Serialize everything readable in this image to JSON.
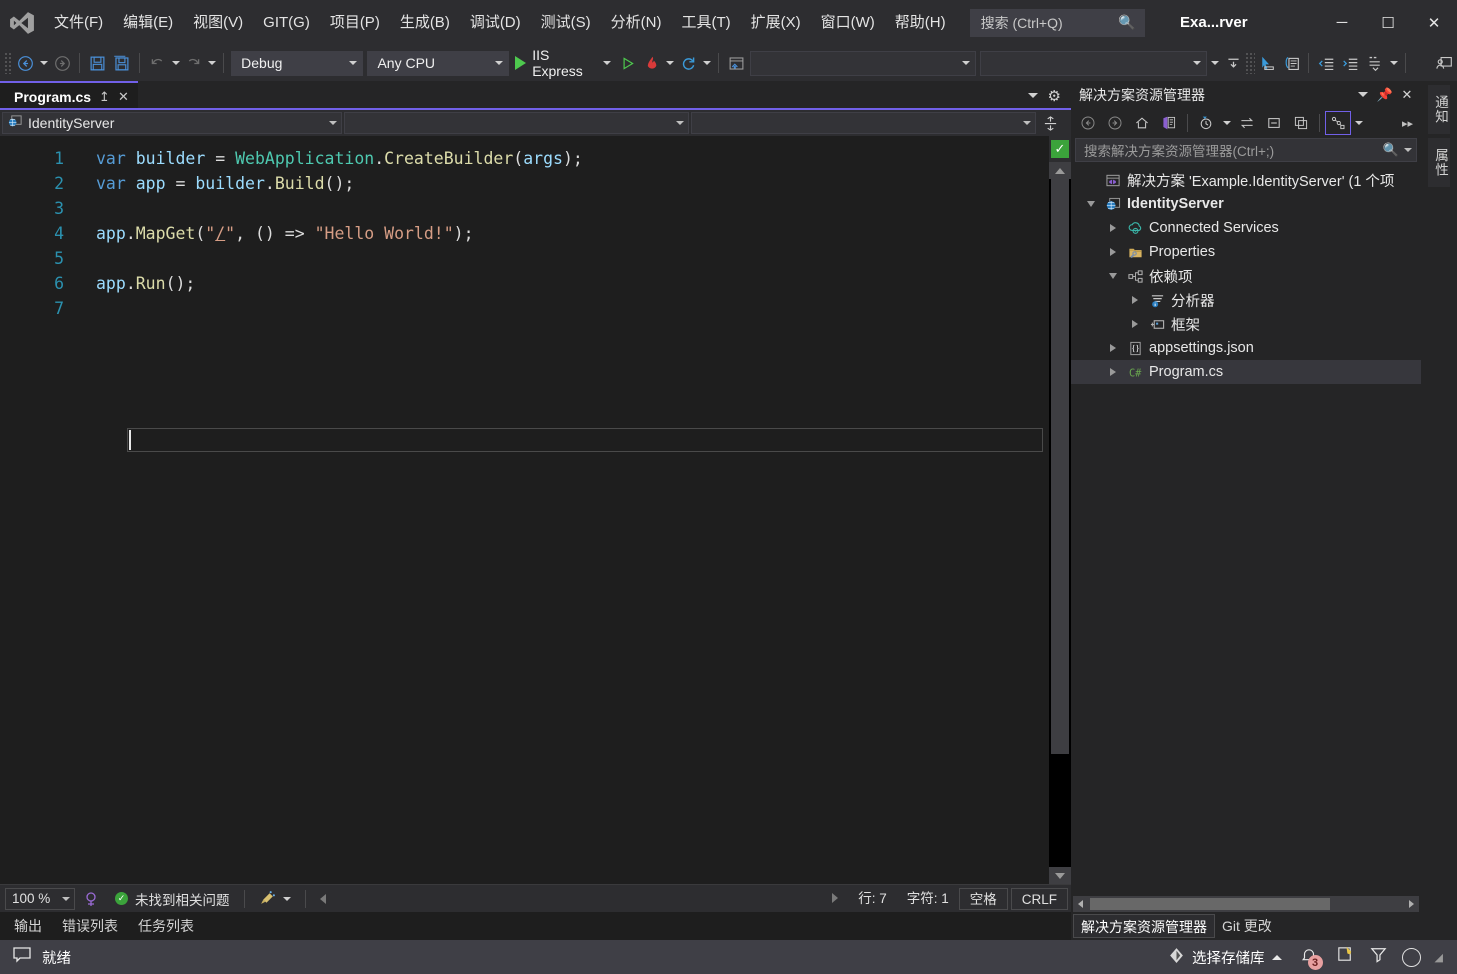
{
  "window": {
    "title": "Exa...rver",
    "minimize_label": "─",
    "maximize_label": "☐",
    "close_label": "✕"
  },
  "menu": {
    "items": [
      {
        "label": "文件(F)"
      },
      {
        "label": "编辑(E)"
      },
      {
        "label": "视图(V)"
      },
      {
        "label": "GIT(G)"
      },
      {
        "label": "项目(P)"
      },
      {
        "label": "生成(B)"
      },
      {
        "label": "调试(D)"
      },
      {
        "label": "测试(S)"
      },
      {
        "label": "分析(N)"
      },
      {
        "label": "工具(T)"
      },
      {
        "label": "扩展(X)"
      },
      {
        "label": "窗口(W)"
      },
      {
        "label": "帮助(H)"
      }
    ]
  },
  "search": {
    "label": "搜索 (Ctrl+Q)",
    "icon": "magnifier-icon"
  },
  "toolbar": {
    "configuration": "Debug",
    "platform": "Any CPU",
    "run_target": "IIS Express",
    "combo_empty_1": "",
    "combo_empty_2": ""
  },
  "editor": {
    "tab_name": "Program.cs",
    "pin_label": "↥",
    "close_label": "✕",
    "navbar": {
      "project": "IdentityServer",
      "type_dropdown": "",
      "member_dropdown": ""
    },
    "code_lines": [
      {
        "n": "1",
        "text": "var builder = WebApplication.CreateBuilder(args);"
      },
      {
        "n": "2",
        "text": "var app = builder.Build();"
      },
      {
        "n": "3",
        "text": ""
      },
      {
        "n": "4",
        "text": "app.MapGet(\"/\", () => \"Hello World!\");"
      },
      {
        "n": "5",
        "text": ""
      },
      {
        "n": "6",
        "text": "app.Run();"
      },
      {
        "n": "7",
        "text": ""
      }
    ],
    "status": {
      "zoom": "100 %",
      "issues": "未找到相关问题",
      "line": "行: 7",
      "column": "字符: 1",
      "indent": "空格",
      "eol": "CRLF"
    },
    "health_indicator": "ok"
  },
  "doc_tabs": {
    "items": [
      {
        "label": "输出"
      },
      {
        "label": "错误列表"
      },
      {
        "label": "任务列表"
      }
    ]
  },
  "solution_explorer": {
    "title": "解决方案资源管理器",
    "search_placeholder": "搜索解决方案资源管理器(Ctrl+;)",
    "tree": [
      {
        "label": "解决方案 'Example.IdentityServer' (1 个项",
        "indent": 0,
        "twisty": "none",
        "icon": "solution-icon",
        "bold": false,
        "selected": false
      },
      {
        "label": "IdentityServer",
        "indent": 1,
        "twisty": "down",
        "icon": "project-web-icon",
        "bold": true,
        "selected": false
      },
      {
        "label": "Connected Services",
        "indent": 2,
        "twisty": "right",
        "icon": "connected-services-icon",
        "bold": false,
        "selected": false
      },
      {
        "label": "Properties",
        "indent": 2,
        "twisty": "right",
        "icon": "properties-folder-icon",
        "bold": false,
        "selected": false
      },
      {
        "label": "依赖项",
        "indent": 2,
        "twisty": "down",
        "icon": "dependencies-icon",
        "bold": false,
        "selected": false
      },
      {
        "label": "分析器",
        "indent": 3,
        "twisty": "right",
        "icon": "analyzers-icon",
        "bold": false,
        "selected": false
      },
      {
        "label": "框架",
        "indent": 3,
        "twisty": "right",
        "icon": "frameworks-icon",
        "bold": false,
        "selected": false
      },
      {
        "label": "appsettings.json",
        "indent": 2,
        "twisty": "right",
        "icon": "json-file-icon",
        "bold": false,
        "selected": false
      },
      {
        "label": "Program.cs",
        "indent": 2,
        "twisty": "right",
        "icon": "csharp-file-icon",
        "bold": false,
        "selected": true
      }
    ],
    "tabs": [
      {
        "label": "解决方案资源管理器",
        "active": true
      },
      {
        "label": "Git 更改",
        "active": false
      }
    ]
  },
  "rail": {
    "tabs": [
      {
        "label": "通知"
      },
      {
        "label": "属性"
      }
    ]
  },
  "statusbar": {
    "message": "就绪",
    "repository": "选择存储库",
    "notification_count": "3"
  },
  "colors": {
    "accent": "#7160e8",
    "status_bg": "#3f3f46",
    "keyword": "#569cd6",
    "type": "#4ec9b0",
    "method": "#dcdcaa",
    "string": "#d69d85",
    "line_number": "#2b91af",
    "ok_green": "#3ba33b"
  }
}
